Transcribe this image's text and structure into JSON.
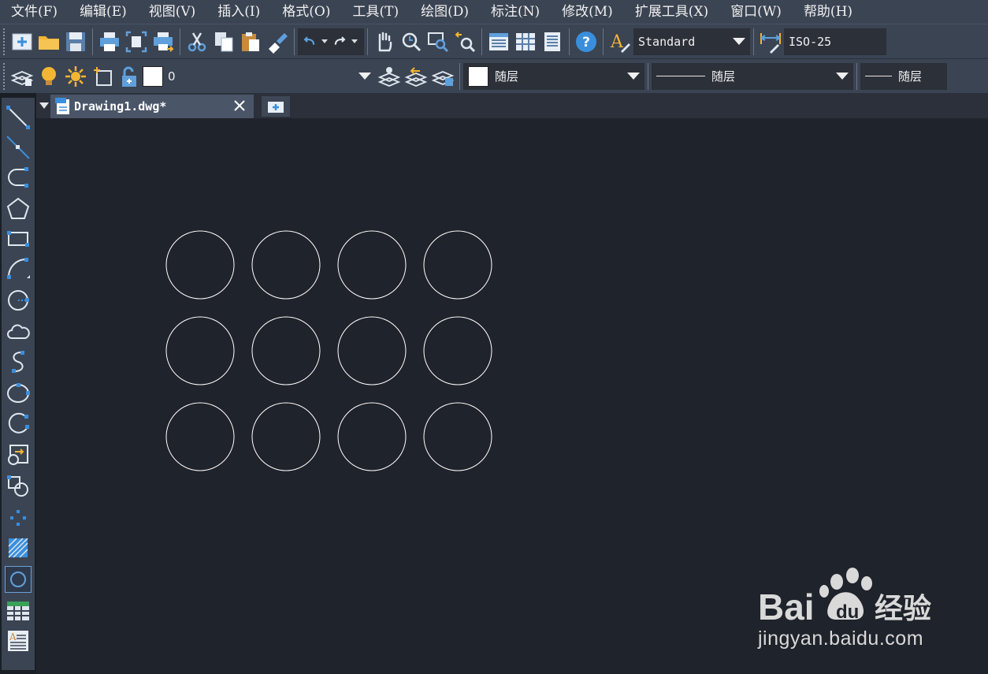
{
  "menu": [
    {
      "label": "文件(F)"
    },
    {
      "label": "编辑(E)"
    },
    {
      "label": "视图(V)"
    },
    {
      "label": "插入(I)"
    },
    {
      "label": "格式(O)"
    },
    {
      "label": "工具(T)"
    },
    {
      "label": "绘图(D)"
    },
    {
      "label": "标注(N)"
    },
    {
      "label": "修改(M)"
    },
    {
      "label": "扩展工具(X)"
    },
    {
      "label": "窗口(W)"
    },
    {
      "label": "帮助(H)"
    }
  ],
  "toolbar": {
    "text_style": "Standard",
    "dim_style": "ISO-25",
    "layer": "0",
    "color": "随层",
    "linetype": "随层",
    "lineweight": "随层"
  },
  "document": {
    "tab_title": "Drawing1.dwg*"
  },
  "drawing": {
    "entity_type": "circle",
    "rows": 3,
    "columns": 4,
    "stroke_color": "#ffffff",
    "background": "#1f232b"
  },
  "colors": {
    "menu_bg": "#3b4453",
    "canvas_bg": "#1f232b",
    "accent_blue": "#3a8fdc",
    "accent_yellow": "#f2b632"
  },
  "icons": {
    "left_palette": [
      "line-icon",
      "construction-line-icon",
      "polyline-icon",
      "polygon-icon",
      "rectangle-icon",
      "arc-icon",
      "circle-icon",
      "revision-cloud-icon",
      "spline-icon",
      "ellipse-icon",
      "ellipse-arc-icon",
      "insert-block-icon",
      "make-block-icon",
      "point-icon",
      "hatch-icon",
      "region-icon",
      "table-icon",
      "mtext-icon"
    ]
  },
  "watermark": {
    "brand": "Bai du 经验",
    "url": "jingyan.baidu.com"
  }
}
